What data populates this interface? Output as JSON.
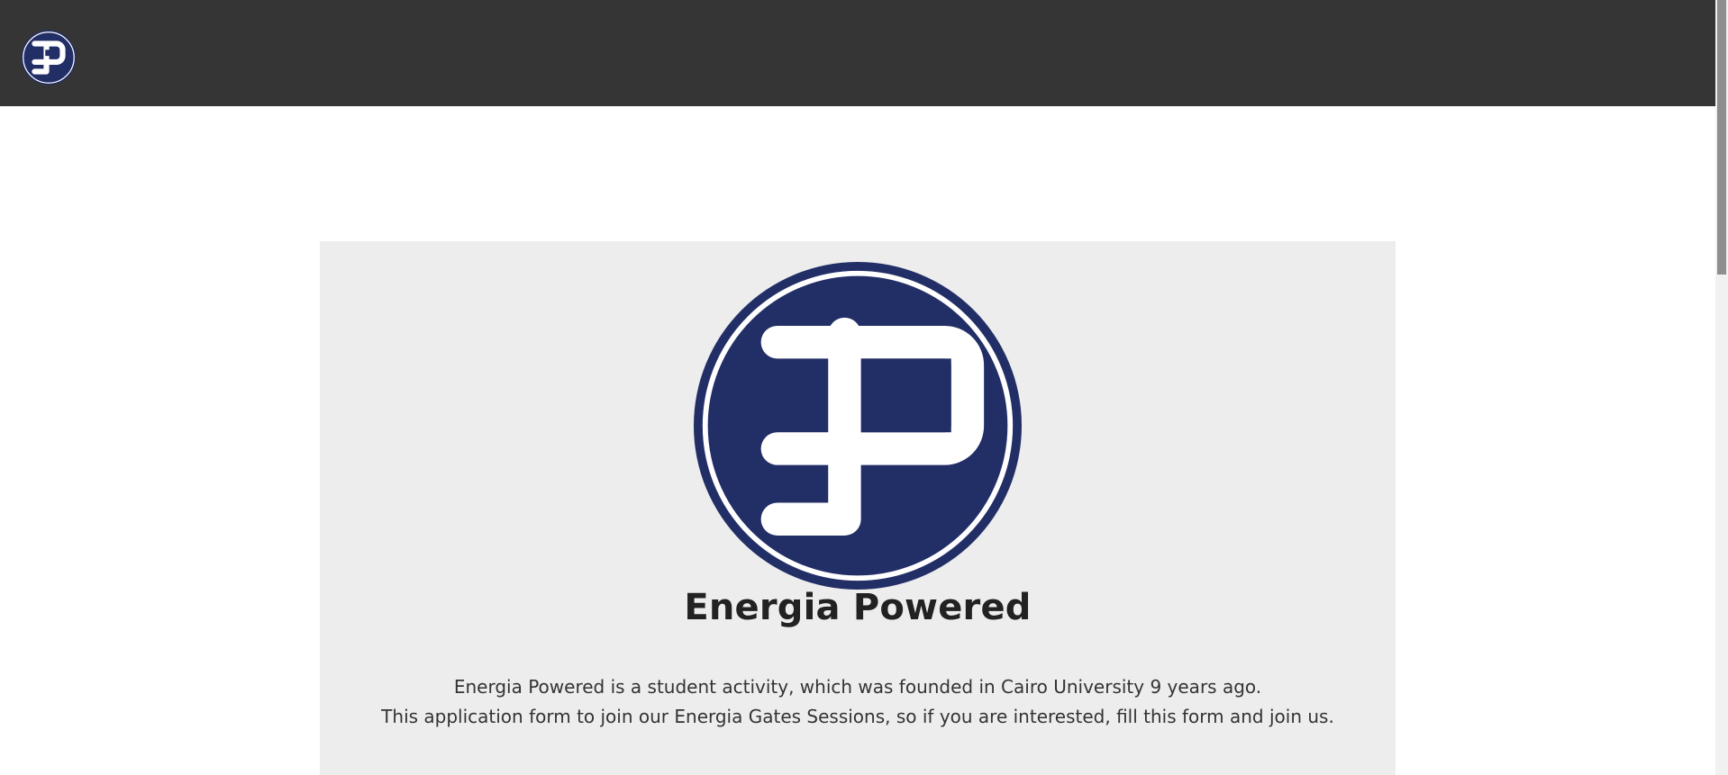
{
  "header": {
    "logo_icon": "energia-powered-logo-icon",
    "background_color": "#353535"
  },
  "brand": {
    "primary_color": "#222e66",
    "logo_text": "EP"
  },
  "main": {
    "title": "Energia Powered",
    "description_lines": [
      "Energia Powered is a student activity, which was founded in Cairo University 9 years ago.",
      "This application form to join our Energia Gates Sessions, so if you are interested, fill this form and join us."
    ]
  }
}
